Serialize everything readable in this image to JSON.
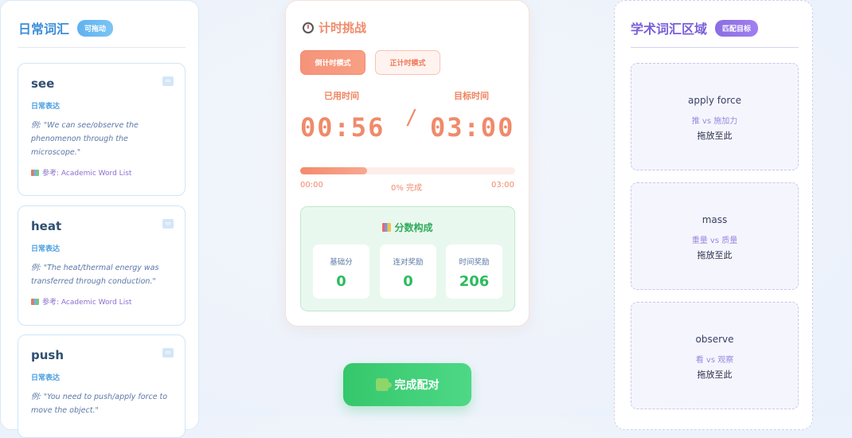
{
  "left_panel": {
    "title": "日常词汇",
    "badge": "可拖动",
    "cards": [
      {
        "word": "see",
        "tag": "日常表达",
        "example": "例: \"We can see/observe the phenomenon through the microscope.\"",
        "ref": "参考: Academic Word List"
      },
      {
        "word": "heat",
        "tag": "日常表达",
        "example": "例: \"The heat/thermal energy was transferred through conduction.\"",
        "ref": "参考: Academic Word List"
      },
      {
        "word": "push",
        "tag": "日常表达",
        "example": "例: \"You need to push/apply force to move the object.\"",
        "ref": ""
      }
    ]
  },
  "timer": {
    "title": "计时挑战",
    "mode_countdown": "倒计时模式",
    "mode_countup": "正计时模式",
    "elapsed_label": "已用时间",
    "target_label": "目标时间",
    "elapsed": "00:56",
    "target": "03:00",
    "progress": 0.31,
    "progress_start": "00:00",
    "progress_status": "0% 完成",
    "progress_end": "03:00",
    "score_title": "分数构成",
    "scores": [
      {
        "label": "基础分",
        "value": "0"
      },
      {
        "label": "连对奖励",
        "value": "0"
      },
      {
        "label": "时间奖励",
        "value": "206"
      }
    ]
  },
  "finish_button": "完成配对",
  "right_panel": {
    "title": "学术词汇区域",
    "badge": "匹配目标",
    "zones": [
      {
        "term": "apply force",
        "vs": "推 vs 施加力",
        "hint": "拖放至此"
      },
      {
        "term": "mass",
        "vs": "重量 vs 质量",
        "hint": "拖放至此"
      },
      {
        "term": "observe",
        "vs": "看 vs 观察",
        "hint": "拖放至此"
      }
    ]
  }
}
